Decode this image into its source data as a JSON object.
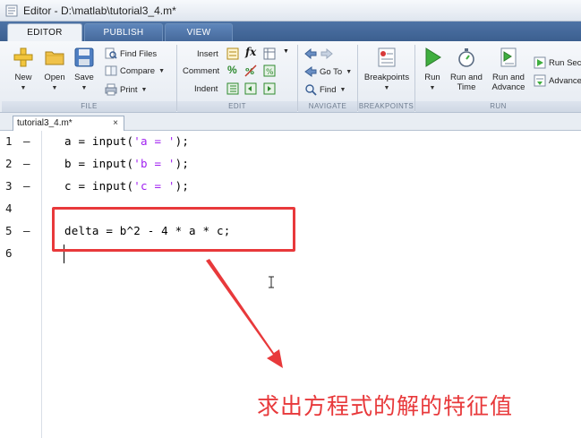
{
  "window": {
    "title": "Editor - D:\\matlab\\tutorial3_4.m*"
  },
  "tabs": [
    {
      "label": "EDITOR",
      "active": true
    },
    {
      "label": "PUBLISH",
      "active": false
    },
    {
      "label": "VIEW",
      "active": false
    }
  ],
  "toolstrip": {
    "file": {
      "label": "FILE",
      "new": "New",
      "open": "Open",
      "save": "Save",
      "find_files": "Find Files",
      "compare": "Compare",
      "print": "Print"
    },
    "edit": {
      "label": "EDIT",
      "insert": "Insert",
      "comment": "Comment",
      "indent": "Indent",
      "fx": "fx"
    },
    "navigate": {
      "label": "NAVIGATE",
      "goto": "Go To",
      "find": "Find"
    },
    "breakpoints": {
      "label": "BREAKPOINTS",
      "button": "Breakpoints"
    },
    "run": {
      "label": "RUN",
      "run": "Run",
      "run_time_1": "Run and",
      "run_time_2": "Time",
      "run_adv_1": "Run and",
      "run_adv_2": "Advance",
      "run_section": "Run Sect",
      "advance": "Advance"
    }
  },
  "document_tab": {
    "label": "tutorial3_4.m*",
    "close": "×"
  },
  "editor": {
    "lines": [
      {
        "num": "1",
        "dash": "—",
        "pre": "a = input(",
        "str": "'a = '",
        "post": ");"
      },
      {
        "num": "2",
        "dash": "—",
        "pre": "b = input(",
        "str": "'b = '",
        "post": ");"
      },
      {
        "num": "3",
        "dash": "—",
        "pre": "c = input(",
        "str": "'c = '",
        "post": ");"
      },
      {
        "num": "4",
        "dash": "",
        "pre": "",
        "str": "",
        "post": ""
      },
      {
        "num": "5",
        "dash": "—",
        "pre": "delta = b^2 - 4 * a * c;",
        "str": "",
        "post": ""
      },
      {
        "num": "6",
        "dash": "",
        "pre": "",
        "str": "",
        "post": ""
      }
    ]
  },
  "annotation": {
    "text": "求出方程式的解的特征值",
    "color": "#e8393b"
  },
  "colors": {
    "accent": "#3c5f8f",
    "string": "#a020f0",
    "annotation": "#e8393b"
  }
}
